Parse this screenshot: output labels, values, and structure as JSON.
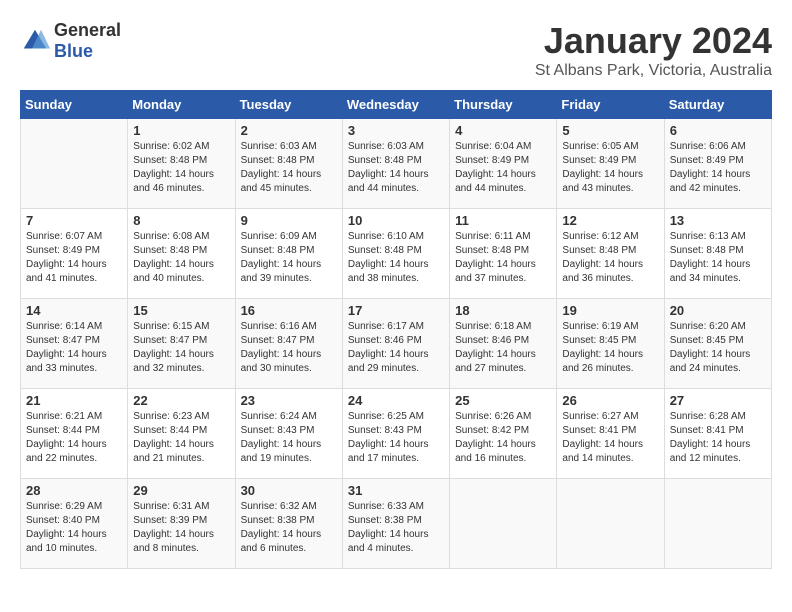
{
  "header": {
    "logo_general": "General",
    "logo_blue": "Blue",
    "title": "January 2024",
    "subtitle": "St Albans Park, Victoria, Australia"
  },
  "calendar": {
    "days_of_week": [
      "Sunday",
      "Monday",
      "Tuesday",
      "Wednesday",
      "Thursday",
      "Friday",
      "Saturday"
    ],
    "weeks": [
      [
        {
          "day": "",
          "info": ""
        },
        {
          "day": "1",
          "info": "Sunrise: 6:02 AM\nSunset: 8:48 PM\nDaylight: 14 hours\nand 46 minutes."
        },
        {
          "day": "2",
          "info": "Sunrise: 6:03 AM\nSunset: 8:48 PM\nDaylight: 14 hours\nand 45 minutes."
        },
        {
          "day": "3",
          "info": "Sunrise: 6:03 AM\nSunset: 8:48 PM\nDaylight: 14 hours\nand 44 minutes."
        },
        {
          "day": "4",
          "info": "Sunrise: 6:04 AM\nSunset: 8:49 PM\nDaylight: 14 hours\nand 44 minutes."
        },
        {
          "day": "5",
          "info": "Sunrise: 6:05 AM\nSunset: 8:49 PM\nDaylight: 14 hours\nand 43 minutes."
        },
        {
          "day": "6",
          "info": "Sunrise: 6:06 AM\nSunset: 8:49 PM\nDaylight: 14 hours\nand 42 minutes."
        }
      ],
      [
        {
          "day": "7",
          "info": "Sunrise: 6:07 AM\nSunset: 8:49 PM\nDaylight: 14 hours\nand 41 minutes."
        },
        {
          "day": "8",
          "info": "Sunrise: 6:08 AM\nSunset: 8:48 PM\nDaylight: 14 hours\nand 40 minutes."
        },
        {
          "day": "9",
          "info": "Sunrise: 6:09 AM\nSunset: 8:48 PM\nDaylight: 14 hours\nand 39 minutes."
        },
        {
          "day": "10",
          "info": "Sunrise: 6:10 AM\nSunset: 8:48 PM\nDaylight: 14 hours\nand 38 minutes."
        },
        {
          "day": "11",
          "info": "Sunrise: 6:11 AM\nSunset: 8:48 PM\nDaylight: 14 hours\nand 37 minutes."
        },
        {
          "day": "12",
          "info": "Sunrise: 6:12 AM\nSunset: 8:48 PM\nDaylight: 14 hours\nand 36 minutes."
        },
        {
          "day": "13",
          "info": "Sunrise: 6:13 AM\nSunset: 8:48 PM\nDaylight: 14 hours\nand 34 minutes."
        }
      ],
      [
        {
          "day": "14",
          "info": "Sunrise: 6:14 AM\nSunset: 8:47 PM\nDaylight: 14 hours\nand 33 minutes."
        },
        {
          "day": "15",
          "info": "Sunrise: 6:15 AM\nSunset: 8:47 PM\nDaylight: 14 hours\nand 32 minutes."
        },
        {
          "day": "16",
          "info": "Sunrise: 6:16 AM\nSunset: 8:47 PM\nDaylight: 14 hours\nand 30 minutes."
        },
        {
          "day": "17",
          "info": "Sunrise: 6:17 AM\nSunset: 8:46 PM\nDaylight: 14 hours\nand 29 minutes."
        },
        {
          "day": "18",
          "info": "Sunrise: 6:18 AM\nSunset: 8:46 PM\nDaylight: 14 hours\nand 27 minutes."
        },
        {
          "day": "19",
          "info": "Sunrise: 6:19 AM\nSunset: 8:45 PM\nDaylight: 14 hours\nand 26 minutes."
        },
        {
          "day": "20",
          "info": "Sunrise: 6:20 AM\nSunset: 8:45 PM\nDaylight: 14 hours\nand 24 minutes."
        }
      ],
      [
        {
          "day": "21",
          "info": "Sunrise: 6:21 AM\nSunset: 8:44 PM\nDaylight: 14 hours\nand 22 minutes."
        },
        {
          "day": "22",
          "info": "Sunrise: 6:23 AM\nSunset: 8:44 PM\nDaylight: 14 hours\nand 21 minutes."
        },
        {
          "day": "23",
          "info": "Sunrise: 6:24 AM\nSunset: 8:43 PM\nDaylight: 14 hours\nand 19 minutes."
        },
        {
          "day": "24",
          "info": "Sunrise: 6:25 AM\nSunset: 8:43 PM\nDaylight: 14 hours\nand 17 minutes."
        },
        {
          "day": "25",
          "info": "Sunrise: 6:26 AM\nSunset: 8:42 PM\nDaylight: 14 hours\nand 16 minutes."
        },
        {
          "day": "26",
          "info": "Sunrise: 6:27 AM\nSunset: 8:41 PM\nDaylight: 14 hours\nand 14 minutes."
        },
        {
          "day": "27",
          "info": "Sunrise: 6:28 AM\nSunset: 8:41 PM\nDaylight: 14 hours\nand 12 minutes."
        }
      ],
      [
        {
          "day": "28",
          "info": "Sunrise: 6:29 AM\nSunset: 8:40 PM\nDaylight: 14 hours\nand 10 minutes."
        },
        {
          "day": "29",
          "info": "Sunrise: 6:31 AM\nSunset: 8:39 PM\nDaylight: 14 hours\nand 8 minutes."
        },
        {
          "day": "30",
          "info": "Sunrise: 6:32 AM\nSunset: 8:38 PM\nDaylight: 14 hours\nand 6 minutes."
        },
        {
          "day": "31",
          "info": "Sunrise: 6:33 AM\nSunset: 8:38 PM\nDaylight: 14 hours\nand 4 minutes."
        },
        {
          "day": "",
          "info": ""
        },
        {
          "day": "",
          "info": ""
        },
        {
          "day": "",
          "info": ""
        }
      ]
    ]
  }
}
